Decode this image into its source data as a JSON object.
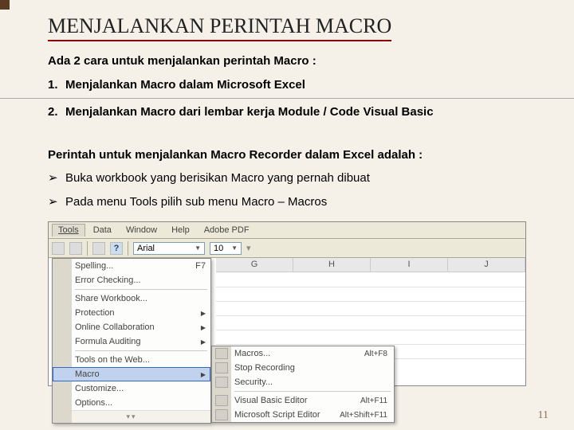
{
  "title": "MENJALANKAN PERINTAH MACRO",
  "intro": "Ada 2 cara untuk menjalankan perintah Macro :",
  "items": [
    {
      "n": "1.",
      "t": "Menjalankan Macro dalam Microsoft Excel"
    },
    {
      "n": "2.",
      "t": "Menjalankan Macro dari lembar kerja Module / Code Visual Basic"
    }
  ],
  "para2": "Perintah untuk menjalankan Macro Recorder dalam Excel adalah :",
  "bullets": [
    "Buka workbook yang berisikan Macro yang pernah dibuat",
    "Pada menu Tools pilih sub menu Macro – Macros"
  ],
  "menubar": [
    "Tools",
    "Data",
    "Window",
    "Help",
    "Adobe PDF"
  ],
  "font_name": "Arial",
  "font_size": "10",
  "tools_menu": [
    {
      "label": "Spelling...",
      "shortcut": "F7"
    },
    {
      "label": "Error Checking..."
    },
    {
      "sep": true
    },
    {
      "label": "Share Workbook..."
    },
    {
      "label": "Protection",
      "sub": true
    },
    {
      "label": "Online Collaboration",
      "sub": true
    },
    {
      "label": "Formula Auditing",
      "sub": true
    },
    {
      "sep": true
    },
    {
      "label": "Tools on the Web..."
    },
    {
      "label": "Macro",
      "sub": true,
      "hl": true
    },
    {
      "label": "Customize..."
    },
    {
      "label": "Options..."
    }
  ],
  "macro_submenu": [
    {
      "label": "Macros...",
      "shortcut": "Alt+F8",
      "icon": true
    },
    {
      "label": "Stop Recording",
      "icon": true
    },
    {
      "label": "Security...",
      "icon": true
    },
    {
      "sep": true
    },
    {
      "label": "Visual Basic Editor",
      "shortcut": "Alt+F11",
      "icon": true
    },
    {
      "label": "Microsoft Script Editor",
      "shortcut": "Alt+Shift+F11",
      "icon": true
    }
  ],
  "columns": [
    "G",
    "H",
    "I",
    "J"
  ],
  "page_number": "11"
}
